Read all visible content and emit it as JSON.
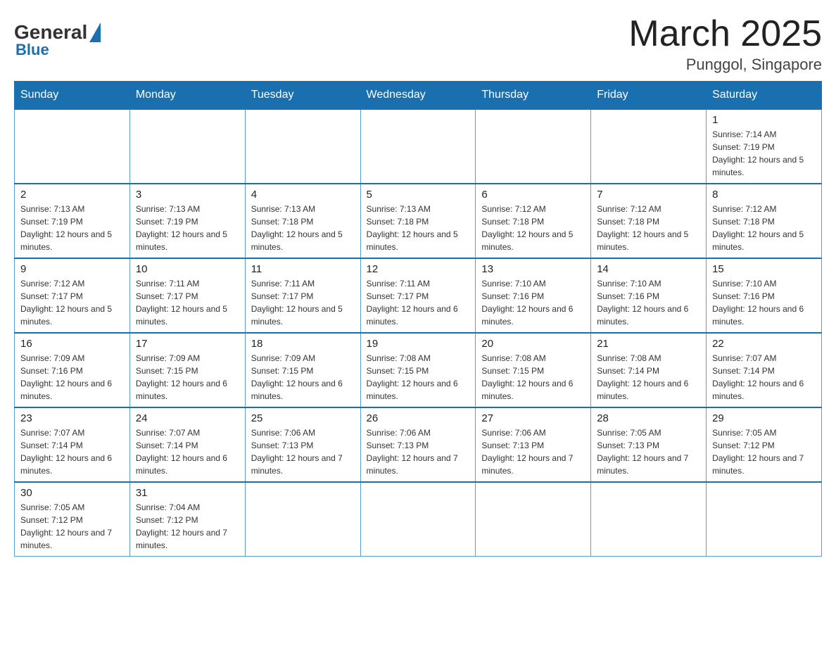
{
  "header": {
    "logo_general": "General",
    "logo_blue": "Blue",
    "month_title": "March 2025",
    "location": "Punggol, Singapore"
  },
  "days_of_week": [
    "Sunday",
    "Monday",
    "Tuesday",
    "Wednesday",
    "Thursday",
    "Friday",
    "Saturday"
  ],
  "weeks": [
    [
      {
        "day": "",
        "info": ""
      },
      {
        "day": "",
        "info": ""
      },
      {
        "day": "",
        "info": ""
      },
      {
        "day": "",
        "info": ""
      },
      {
        "day": "",
        "info": ""
      },
      {
        "day": "",
        "info": ""
      },
      {
        "day": "1",
        "info": "Sunrise: 7:14 AM\nSunset: 7:19 PM\nDaylight: 12 hours and 5 minutes."
      }
    ],
    [
      {
        "day": "2",
        "info": "Sunrise: 7:13 AM\nSunset: 7:19 PM\nDaylight: 12 hours and 5 minutes."
      },
      {
        "day": "3",
        "info": "Sunrise: 7:13 AM\nSunset: 7:19 PM\nDaylight: 12 hours and 5 minutes."
      },
      {
        "day": "4",
        "info": "Sunrise: 7:13 AM\nSunset: 7:18 PM\nDaylight: 12 hours and 5 minutes."
      },
      {
        "day": "5",
        "info": "Sunrise: 7:13 AM\nSunset: 7:18 PM\nDaylight: 12 hours and 5 minutes."
      },
      {
        "day": "6",
        "info": "Sunrise: 7:12 AM\nSunset: 7:18 PM\nDaylight: 12 hours and 5 minutes."
      },
      {
        "day": "7",
        "info": "Sunrise: 7:12 AM\nSunset: 7:18 PM\nDaylight: 12 hours and 5 minutes."
      },
      {
        "day": "8",
        "info": "Sunrise: 7:12 AM\nSunset: 7:18 PM\nDaylight: 12 hours and 5 minutes."
      }
    ],
    [
      {
        "day": "9",
        "info": "Sunrise: 7:12 AM\nSunset: 7:17 PM\nDaylight: 12 hours and 5 minutes."
      },
      {
        "day": "10",
        "info": "Sunrise: 7:11 AM\nSunset: 7:17 PM\nDaylight: 12 hours and 5 minutes."
      },
      {
        "day": "11",
        "info": "Sunrise: 7:11 AM\nSunset: 7:17 PM\nDaylight: 12 hours and 5 minutes."
      },
      {
        "day": "12",
        "info": "Sunrise: 7:11 AM\nSunset: 7:17 PM\nDaylight: 12 hours and 6 minutes."
      },
      {
        "day": "13",
        "info": "Sunrise: 7:10 AM\nSunset: 7:16 PM\nDaylight: 12 hours and 6 minutes."
      },
      {
        "day": "14",
        "info": "Sunrise: 7:10 AM\nSunset: 7:16 PM\nDaylight: 12 hours and 6 minutes."
      },
      {
        "day": "15",
        "info": "Sunrise: 7:10 AM\nSunset: 7:16 PM\nDaylight: 12 hours and 6 minutes."
      }
    ],
    [
      {
        "day": "16",
        "info": "Sunrise: 7:09 AM\nSunset: 7:16 PM\nDaylight: 12 hours and 6 minutes."
      },
      {
        "day": "17",
        "info": "Sunrise: 7:09 AM\nSunset: 7:15 PM\nDaylight: 12 hours and 6 minutes."
      },
      {
        "day": "18",
        "info": "Sunrise: 7:09 AM\nSunset: 7:15 PM\nDaylight: 12 hours and 6 minutes."
      },
      {
        "day": "19",
        "info": "Sunrise: 7:08 AM\nSunset: 7:15 PM\nDaylight: 12 hours and 6 minutes."
      },
      {
        "day": "20",
        "info": "Sunrise: 7:08 AM\nSunset: 7:15 PM\nDaylight: 12 hours and 6 minutes."
      },
      {
        "day": "21",
        "info": "Sunrise: 7:08 AM\nSunset: 7:14 PM\nDaylight: 12 hours and 6 minutes."
      },
      {
        "day": "22",
        "info": "Sunrise: 7:07 AM\nSunset: 7:14 PM\nDaylight: 12 hours and 6 minutes."
      }
    ],
    [
      {
        "day": "23",
        "info": "Sunrise: 7:07 AM\nSunset: 7:14 PM\nDaylight: 12 hours and 6 minutes."
      },
      {
        "day": "24",
        "info": "Sunrise: 7:07 AM\nSunset: 7:14 PM\nDaylight: 12 hours and 6 minutes."
      },
      {
        "day": "25",
        "info": "Sunrise: 7:06 AM\nSunset: 7:13 PM\nDaylight: 12 hours and 7 minutes."
      },
      {
        "day": "26",
        "info": "Sunrise: 7:06 AM\nSunset: 7:13 PM\nDaylight: 12 hours and 7 minutes."
      },
      {
        "day": "27",
        "info": "Sunrise: 7:06 AM\nSunset: 7:13 PM\nDaylight: 12 hours and 7 minutes."
      },
      {
        "day": "28",
        "info": "Sunrise: 7:05 AM\nSunset: 7:13 PM\nDaylight: 12 hours and 7 minutes."
      },
      {
        "day": "29",
        "info": "Sunrise: 7:05 AM\nSunset: 7:12 PM\nDaylight: 12 hours and 7 minutes."
      }
    ],
    [
      {
        "day": "30",
        "info": "Sunrise: 7:05 AM\nSunset: 7:12 PM\nDaylight: 12 hours and 7 minutes."
      },
      {
        "day": "31",
        "info": "Sunrise: 7:04 AM\nSunset: 7:12 PM\nDaylight: 12 hours and 7 minutes."
      },
      {
        "day": "",
        "info": ""
      },
      {
        "day": "",
        "info": ""
      },
      {
        "day": "",
        "info": ""
      },
      {
        "day": "",
        "info": ""
      },
      {
        "day": "",
        "info": ""
      }
    ]
  ]
}
